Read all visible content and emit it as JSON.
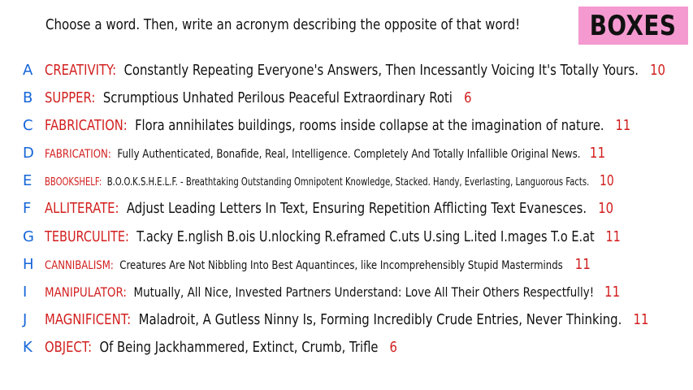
{
  "prompt": "Choose a word. Then, write an acronym describing the opposite of that word!",
  "game_title": "BOXES",
  "colors": {
    "letter": "#1565d8",
    "word": "#d21f1f",
    "score": "#d21f1f",
    "badge": "#f49ad0",
    "text": "#111111"
  },
  "entries": [
    {
      "letter": "A",
      "word": "CREATIVITY",
      "acronym": "Constantly Repeating Everyone's Answers, Then Incessantly Voicing It's Totally Yours.",
      "score": "10"
    },
    {
      "letter": "B",
      "word": "SUPPER",
      "acronym": "Scrumptious Unhated Perilous Peaceful Extraordinary Roti",
      "score": "6"
    },
    {
      "letter": "C",
      "word": "FABRICATION",
      "acronym": "Flora annihilates buildings, rooms inside collapse at the imagination of nature.",
      "score": "11"
    },
    {
      "letter": "D",
      "word": "FABRICATION",
      "acronym": "Fully Authenticated, Bonafide, Real, Intelligence. Completely And Totally Infallible Original News.",
      "score": "11"
    },
    {
      "letter": "E",
      "word": "BBOOKSHELF",
      "acronym": "B.O.O.K.S.H.E.L.F. - Breathtaking Outstanding Omnipotent Knowledge, Stacked. Handy, Everlasting, Languorous Facts.",
      "score": "10"
    },
    {
      "letter": "F",
      "word": "ALLITERATE",
      "acronym": "Adjust Leading Letters In Text, Ensuring Repetition Afflicting Text Evanesces.",
      "score": "10"
    },
    {
      "letter": "G",
      "word": "TEBURCULITE",
      "acronym": "T.acky E.nglish B.ois U.nlocking R.eframed C.uts U.sing L.ited I.mages T.o E.at",
      "score": "11"
    },
    {
      "letter": "H",
      "word": "CANNIBALISM",
      "acronym": "Creatures Are Not Nibbling Into Best Aquantinces, like Incomprehensibly Stupid Masterminds",
      "score": "11"
    },
    {
      "letter": "I",
      "word": "MANIPULATOR",
      "acronym": "Mutually, All Nice, Invested Partners Understand: Love All Their Others Respectfully!",
      "score": "11"
    },
    {
      "letter": "J",
      "word": "MAGNIFICENT",
      "acronym": "Maladroit, A Gutless Ninny Is, Forming Incredibly Crude Entries, Never Thinking.",
      "score": "11"
    },
    {
      "letter": "K",
      "word": "OBJECT",
      "acronym": "Of Being Jackhammered, Extinct, Crumb, Trifle",
      "score": "6"
    }
  ]
}
